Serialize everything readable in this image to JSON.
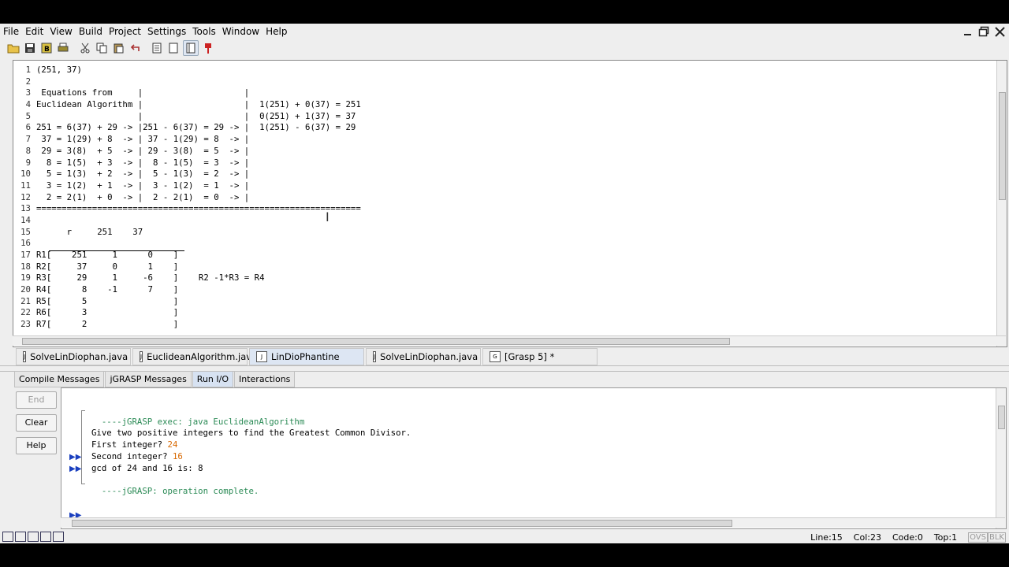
{
  "menubar": {
    "items": [
      "File",
      "Edit",
      "View",
      "Build",
      "Project",
      "Settings",
      "Tools",
      "Window",
      "Help"
    ]
  },
  "window_controls": [
    "minimize-icon",
    "restore-icon",
    "close-icon"
  ],
  "toolbar": {
    "icons": [
      "open-folder-icon",
      "save-icon",
      "browse-icon",
      "print-icon",
      "cut-icon",
      "copy-icon",
      "paste-icon",
      "undo-icon",
      "page-icon",
      "blank-page-icon",
      "page-view-icon",
      "pin-icon"
    ]
  },
  "editor": {
    "lines": [
      {
        "n": "1",
        "t": "(251, 37)"
      },
      {
        "n": "2",
        "t": ""
      },
      {
        "n": "3",
        "t": " Equations from     |                    |"
      },
      {
        "n": "4",
        "t": "Euclidean Algorithm |                    |  1(251) + 0(37) = 251"
      },
      {
        "n": "5",
        "t": "                    |                    |  0(251) + 1(37) = 37"
      },
      {
        "n": "6",
        "t": "251 = 6(37) + 29 -> |251 - 6(37) = 29 -> |  1(251) - 6(37) = 29"
      },
      {
        "n": "7",
        "t": " 37 = 1(29) + 8  -> | 37 - 1(29) = 8  -> |"
      },
      {
        "n": "8",
        "t": " 29 = 3(8)  + 5  -> | 29 - 3(8)  = 5  -> |"
      },
      {
        "n": "9",
        "t": "  8 = 1(5)  + 3  -> |  8 - 1(5)  = 3  -> |"
      },
      {
        "n": "10",
        "t": "  5 = 1(3)  + 2  -> |  5 - 1(3)  = 2  -> |"
      },
      {
        "n": "11",
        "t": "  3 = 1(2)  + 1  -> |  3 - 1(2)  = 1  -> |"
      },
      {
        "n": "12",
        "t": "  2 = 2(1)  + 0  -> |  2 - 2(1)  = 0  -> |"
      },
      {
        "n": "13",
        "t": "================================================================"
      },
      {
        "n": "14",
        "t": ""
      },
      {
        "n": "15",
        "t": "      r     251    37"
      },
      {
        "n": "16",
        "t": ""
      },
      {
        "n": "17",
        "t": "R1[    251     1      0    ]"
      },
      {
        "n": "18",
        "t": "R2[     37     0      1    ]"
      },
      {
        "n": "19",
        "t": "R3[     29     1     -6    ]    R2 -1*R3 = R4"
      },
      {
        "n": "20",
        "t": "R4[      8    -1      7    ]"
      },
      {
        "n": "21",
        "t": "R5[      5                 ]"
      },
      {
        "n": "22",
        "t": "R6[      3                 ]"
      },
      {
        "n": "23",
        "t": "R7[      2                 ]"
      }
    ]
  },
  "file_tabs": [
    {
      "label": "SolveLinDiophan.java",
      "active": false
    },
    {
      "label": "EuclideanAlgorithm.java",
      "active": false
    },
    {
      "label": "LinDioPhantine",
      "active": true
    },
    {
      "label": "SolveLinDiophan.java",
      "active": false
    },
    {
      "label": "[Grasp 5] *",
      "active": false
    }
  ],
  "bottom_tabs": [
    {
      "label": "Compile Messages",
      "active": false
    },
    {
      "label": "jGRASP Messages",
      "active": false
    },
    {
      "label": "Run I/O",
      "active": true
    },
    {
      "label": "Interactions",
      "active": false
    }
  ],
  "side_buttons": {
    "end": "End",
    "clear": "Clear",
    "help": "Help"
  },
  "run_io": {
    "exec_line": "----jGRASP exec: java EuclideanAlgorithm",
    "prompt_line": "Give two positive integers to find the Greatest Common Divisor.",
    "first_prompt": "First integer? ",
    "first_input": "24",
    "second_prompt": "Second integer? ",
    "second_input": "16",
    "result_line": "gcd of 24 and 16 is: 8",
    "complete_line": "----jGRASP: operation complete.",
    "input_marker": "▶▶"
  },
  "status_bar": {
    "line": "Line:15",
    "col": "Col:23",
    "code": "Code:0",
    "top": "Top:1",
    "ovs": "OVS",
    "blk": "BLK"
  }
}
